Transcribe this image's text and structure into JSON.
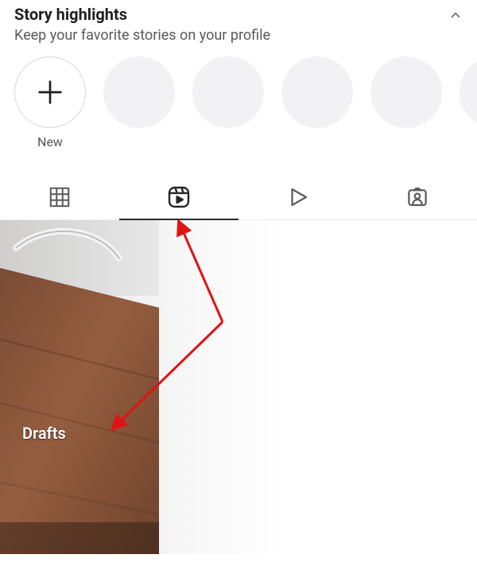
{
  "highlights": {
    "title": "Story highlights",
    "subtitle": "Keep your favorite stories on your profile",
    "new_label": "New"
  },
  "tabs": {
    "grid_icon": "grid-icon",
    "reels_icon": "reels-icon",
    "play_icon": "play-icon",
    "tagged_icon": "tagged-icon",
    "active_index": 1
  },
  "content": {
    "drafts_label": "Drafts"
  },
  "colors": {
    "annotation_arrow": "#e01313",
    "tab_icon": "#5a5a5a",
    "tab_icon_active": "#262626",
    "highlight_placeholder": "#f2f1f4"
  }
}
